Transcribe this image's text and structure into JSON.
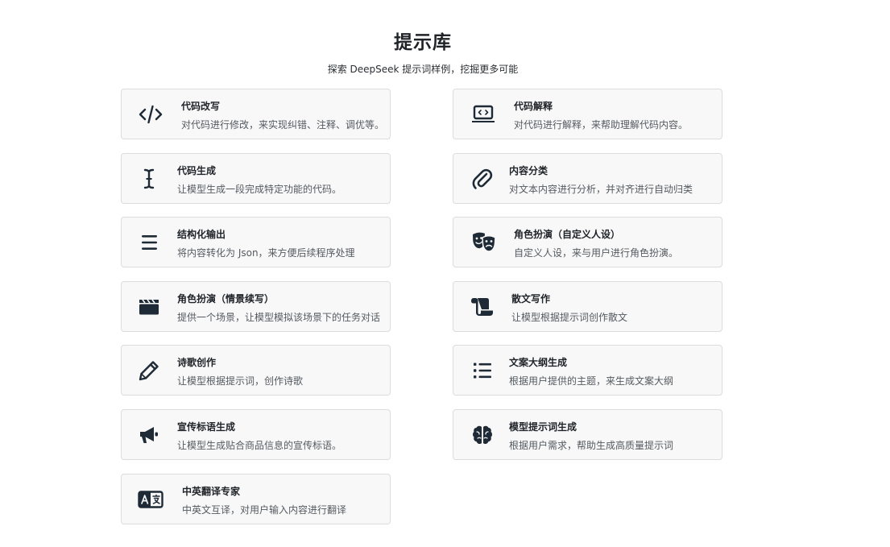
{
  "header": {
    "title": "提示库",
    "subtitle": "探索 DeepSeek 提示词样例，挖掘更多可能"
  },
  "cards": [
    {
      "title": "代码改写",
      "desc": "对代码进行修改，来实现纠错、注释、调优等。",
      "icon": "code-icon"
    },
    {
      "title": "代码解释",
      "desc": "对代码进行解释，来帮助理解代码内容。",
      "icon": "laptop-code-icon"
    },
    {
      "title": "代码生成",
      "desc": "让模型生成一段完成特定功能的代码。",
      "icon": "text-cursor-icon"
    },
    {
      "title": "内容分类",
      "desc": "对文本内容进行分析，并对齐进行自动归类",
      "icon": "paperclip-icon"
    },
    {
      "title": "结构化输出",
      "desc": "将内容转化为 Json，来方便后续程序处理",
      "icon": "menu-lines-icon"
    },
    {
      "title": "角色扮演（自定义人设）",
      "desc": "自定义人设，来与用户进行角色扮演。",
      "icon": "theater-masks-icon"
    },
    {
      "title": "角色扮演（情景续写）",
      "desc": "提供一个场景，让模型模拟该场景下的任务对话",
      "icon": "clapperboard-icon"
    },
    {
      "title": "散文写作",
      "desc": "让模型根据提示词创作散文",
      "icon": "scroll-icon"
    },
    {
      "title": "诗歌创作",
      "desc": "让模型根据提示词，创作诗歌",
      "icon": "pencil-icon"
    },
    {
      "title": "文案大纲生成",
      "desc": "根据用户提供的主题，来生成文案大纲",
      "icon": "list-icon"
    },
    {
      "title": "宣传标语生成",
      "desc": "让模型生成贴合商品信息的宣传标语。",
      "icon": "megaphone-icon"
    },
    {
      "title": "模型提示词生成",
      "desc": "根据用户需求，帮助生成高质量提示词",
      "icon": "brain-icon"
    },
    {
      "title": "中英翻译专家",
      "desc": "中英文互译，对用户输入内容进行翻译",
      "icon": "translate-icon"
    }
  ],
  "colors": {
    "card_bg": "#f8f8f8",
    "card_border": "#dcdcdc",
    "icon": "#1f2a37"
  }
}
